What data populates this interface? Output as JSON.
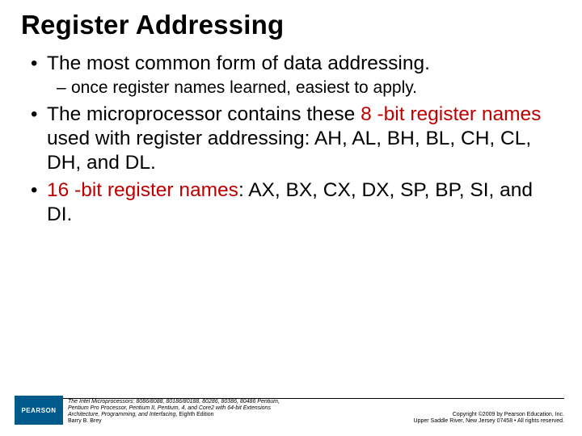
{
  "title": "Register Addressing",
  "bullets": {
    "b1": "The most common form of data addressing.",
    "b1_sub": "once register names learned, easiest to apply.",
    "b2_part1": "The microprocessor contains these ",
    "b2_red1": "8 -bit register names",
    "b2_part2": " used with register addressing: AH, AL, BH, BL, CH, CL, DH, and DL.",
    "b3_part1": "16 -bit register names",
    "b3_part2": ": AX, BX, CX, DX, SP, BP, SI, and DI."
  },
  "footer": {
    "logo": "PEARSON",
    "book_line1": "The Intel Microprocessors: 8086/8088, 80186/80188, 80286, 80386, 80486 Pentium,",
    "book_line2": "Pentium Pro Processor, Pentium II, Pentium, 4, and Core2 with 64-bit Extensions",
    "book_line3": "Architecture, Programming, and Interfacing",
    "book_line3b": ", Eighth Edition",
    "book_line4": "Barry B. Brey",
    "copy_line1": "Copyright ©2009 by Pearson Education, Inc.",
    "copy_line2": "Upper Saddle River, New Jersey 07458 • All rights reserved."
  }
}
